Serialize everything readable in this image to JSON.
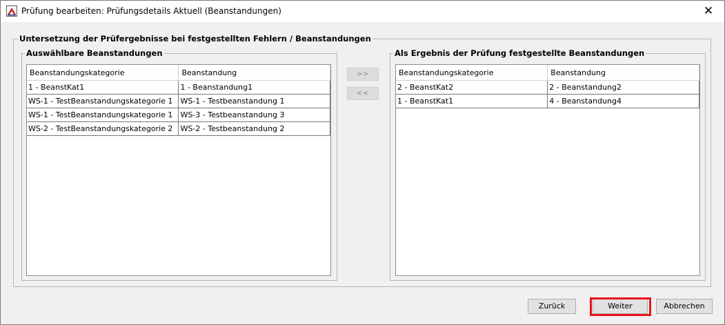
{
  "window": {
    "title": "Prüfung bearbeiten: Prüfungsdetails Aktuell (Beanstandungen)",
    "close_glyph": "✕"
  },
  "outer_group": {
    "legend": "Untersetzung der Prüfergebnisse bei festgestellten Fehlern / Beanstandungen"
  },
  "left_group": {
    "legend": "Auswählbare Beanstandungen",
    "columns": [
      "Beanstandungskategorie",
      "Beanstandung"
    ],
    "rows": [
      [
        "1 - BeanstKat1",
        "1 - Beanstandung1"
      ],
      [
        "WS-1 - TestBeanstandungskategorie 1",
        "WS-1 - Testbeanstandung 1"
      ],
      [
        "WS-1 - TestBeanstandungskategorie 1",
        "WS-3 - Testbeanstandung 3"
      ],
      [
        "WS-2 - TestBeanstandungskategorie 2",
        "WS-2 - Testbeanstandung 2"
      ]
    ]
  },
  "transfer": {
    "add_label": ">>",
    "remove_label": "<<"
  },
  "right_group": {
    "legend": "Als Ergebnis der Prüfung festgestellte Beanstandungen",
    "columns": [
      "Beanstandungskategorie",
      "Beanstandung"
    ],
    "rows": [
      [
        "2 - BeanstKat2",
        "2 - Beanstandung2"
      ],
      [
        "1 - BeanstKat1",
        "4 - Beanstandung4"
      ]
    ]
  },
  "footer": {
    "back_label": "Zurück",
    "next_label": "Weiter",
    "cancel_label": "Abbrechen"
  },
  "colors": {
    "highlight": "#e8141c"
  }
}
